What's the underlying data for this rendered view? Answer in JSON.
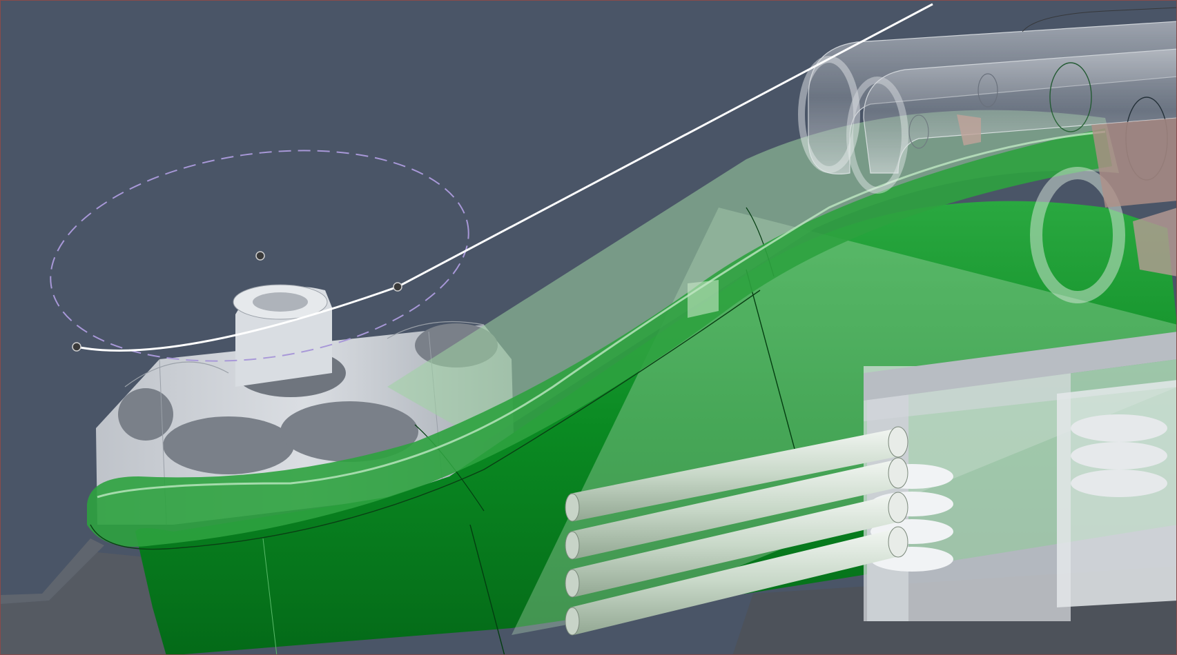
{
  "viewport": {
    "view": "3d-cad-model-viewport",
    "background_color": "#4a5567",
    "border_color": "#8a4a4a"
  },
  "scene": {
    "colors": {
      "green_body": "#0a8a22",
      "green_dark": "#046a18",
      "green_translucent": "#9fd3a3",
      "gray_part": "#cfd3d8",
      "gray_shadow": "#8e949c",
      "sketch_line": "#ffffff",
      "construction_ellipse": "#a898d8",
      "sketch_point": "#3a3a3a",
      "copper_part": "#b09088"
    },
    "sketch": {
      "curve": "spline-path",
      "profile": "construction-ellipse",
      "points": [
        "spline-start-point",
        "spline-control-point",
        "ellipse-center-point"
      ]
    }
  }
}
